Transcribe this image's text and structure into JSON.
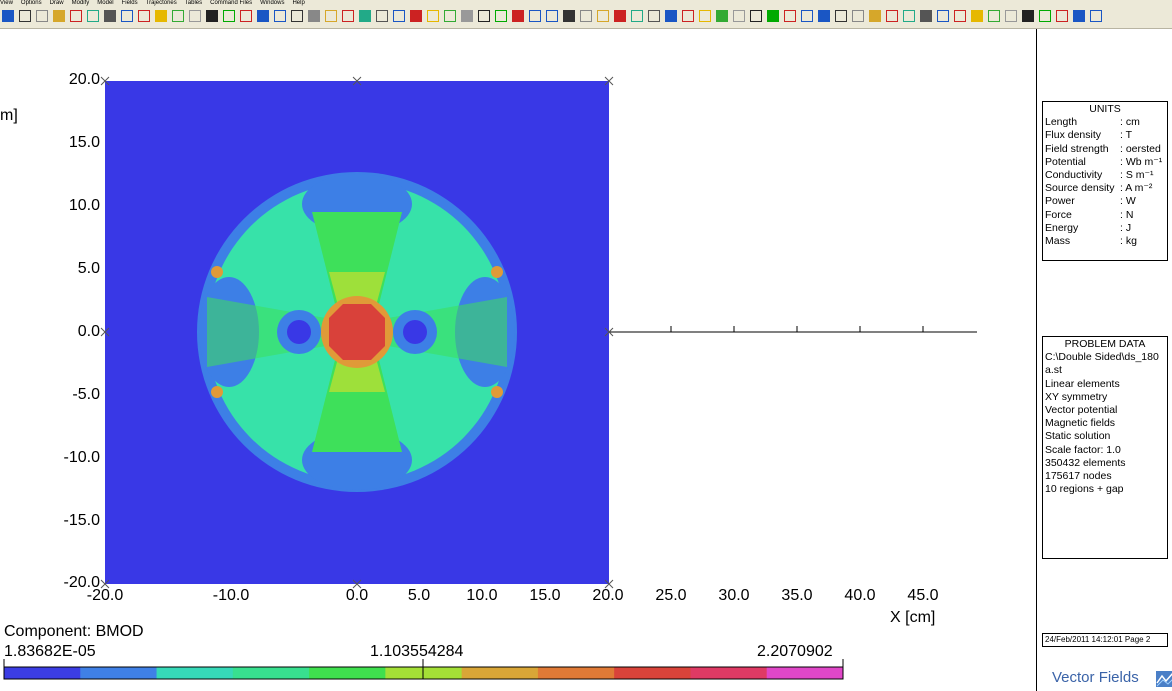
{
  "menu": [
    "View",
    "Options",
    "Draw",
    "Modify",
    "Model",
    "Fields",
    "Trajectories",
    "Tables",
    "Command Files",
    "Windows",
    "Help"
  ],
  "plot": {
    "y_tick_labels": [
      "20.0",
      "15.0",
      "10.0",
      "5.0",
      "0.0",
      "-5.0",
      "-10.0",
      "-15.0",
      "-20.0"
    ],
    "x_tick_labels": [
      "-20.0",
      "-10.0",
      "0.0",
      "5.0",
      "10.0",
      "15.0",
      "20.0",
      "25.0",
      "30.0",
      "35.0",
      "40.0",
      "45.0"
    ],
    "x_axis_label": "X [cm]",
    "y_axis_label_fragment": "m]",
    "component_label": "Component: BMOD",
    "scale_min": "1.83682E-05",
    "scale_mid": "1.103554284",
    "scale_max": "2.2070902",
    "scale_colors": [
      "#3b3de4",
      "#3f80e6",
      "#36d9b8",
      "#38e08f",
      "#3fe04e",
      "#a4e036",
      "#d9a637",
      "#e07a36",
      "#d9433a",
      "#df3a64",
      "#e047c8"
    ],
    "contour_colors": {
      "background": "#3938e6",
      "level1": "#3d7fe6",
      "level2": "#37e2a9",
      "level3": "#3ee05a",
      "level4": "#9ee03a",
      "level5": "#e09a38",
      "level6": "#e07a36",
      "core": "#d9413a"
    }
  },
  "units": {
    "title": "UNITS",
    "rows": [
      {
        "k": "Length",
        "v": ": cm"
      },
      {
        "k": "Flux density",
        "v": ": T"
      },
      {
        "k": "Field strength",
        "v": ": oersted"
      },
      {
        "k": "Potential",
        "v": ": Wb m⁻¹"
      },
      {
        "k": "Conductivity",
        "v": ": S m⁻¹"
      },
      {
        "k": "Source density",
        "v": ": A m⁻²"
      },
      {
        "k": "Power",
        "v": ": W"
      },
      {
        "k": "Force",
        "v": ": N"
      },
      {
        "k": "Energy",
        "v": ": J"
      },
      {
        "k": "Mass",
        "v": ": kg"
      }
    ]
  },
  "problem": {
    "title": "PROBLEM DATA",
    "lines": [
      "C:\\Double Sided\\ds_180a.st",
      "Linear elements",
      "XY symmetry",
      "Vector potential",
      "Magnetic fields",
      "Static solution",
      "Scale factor: 1.0",
      "350432 elements",
      "175617 nodes",
      "10 regions + gap"
    ]
  },
  "footer": {
    "date": "24/Feb/2011 14:12:01 Page 2",
    "brand": "Vector Fields"
  }
}
